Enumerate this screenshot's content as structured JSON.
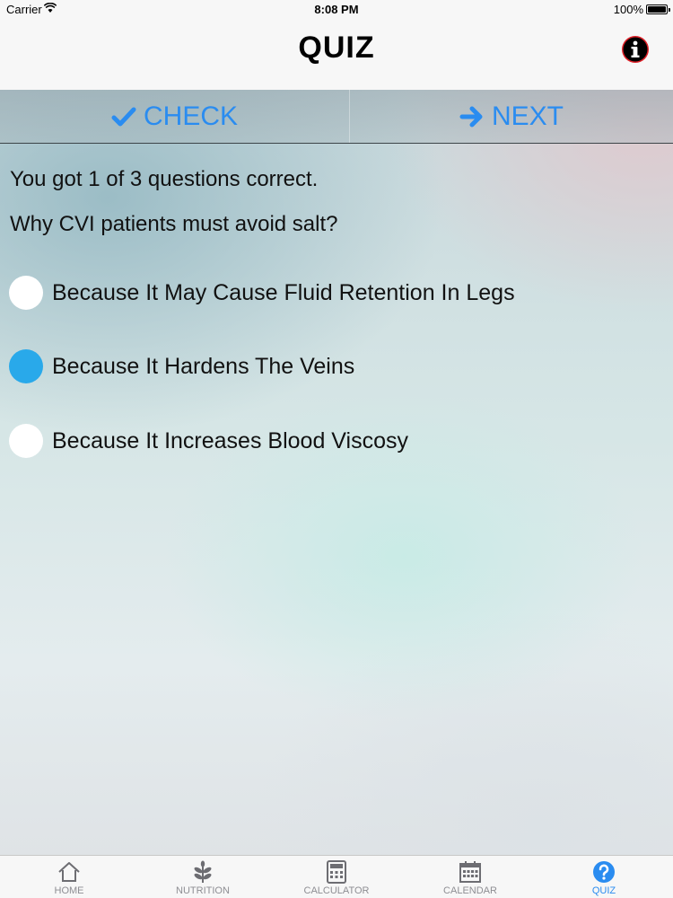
{
  "status_bar": {
    "carrier": "Carrier",
    "time": "8:08 PM",
    "battery": "100%"
  },
  "nav": {
    "title": "QUIZ",
    "info_icon": "info-icon"
  },
  "actions": {
    "check_label": "CHECK",
    "next_label": "NEXT",
    "accent_color": "#2a8cf0"
  },
  "quiz": {
    "result": "You got 1 of 3 questions correct.",
    "question": "Why CVI patients must avoid salt?",
    "options": [
      {
        "label": "Because It May Cause Fluid Retention In Legs",
        "selected": false
      },
      {
        "label": "Because It Hardens The Veins",
        "selected": true
      },
      {
        "label": "Because It Increases Blood Viscosy",
        "selected": false
      }
    ],
    "selected_color": "#29a9ea"
  },
  "tabs": [
    {
      "label": "HOME",
      "icon": "home-icon",
      "active": false
    },
    {
      "label": "NUTRITION",
      "icon": "leaf-icon",
      "active": false
    },
    {
      "label": "CALCULATOR",
      "icon": "calculator-icon",
      "active": false
    },
    {
      "label": "CALENDAR",
      "icon": "calendar-icon",
      "active": false
    },
    {
      "label": "QUIZ",
      "icon": "question-icon",
      "active": true
    }
  ]
}
